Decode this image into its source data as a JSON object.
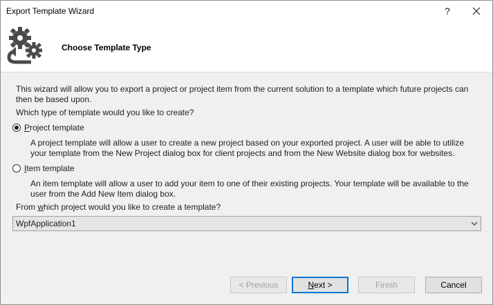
{
  "window": {
    "title": "Export Template Wizard",
    "help_label": "?"
  },
  "header": {
    "page_title": "Choose Template Type"
  },
  "content": {
    "intro": "This wizard will allow you to export a project or project item from the current solution to a template which future projects can then be based upon.",
    "question": "Which type of template would you like to create?",
    "options": [
      {
        "access_key": "P",
        "label_rest": "roject template",
        "checked": true,
        "description": "A project template will allow a user to create a new project based on your exported project. A user will be able to utilize your template from the New Project dialog box for client projects and from the New Website dialog box for websites."
      },
      {
        "access_key": "I",
        "label_rest": "tem template",
        "checked": false,
        "description": "An item template will allow a user to add your item to one of their existing projects. Your template will be available to the user from the Add New Item dialog box."
      }
    ],
    "project_question_pre": "From ",
    "project_question_key": "w",
    "project_question_post": "hich project would you like to create a template?",
    "project_select": {
      "value": "WpfApplication1"
    }
  },
  "buttons": {
    "previous": {
      "label": "< Previous",
      "enabled": false
    },
    "next": {
      "pre": "",
      "key": "N",
      "post": "ext >",
      "enabled": true
    },
    "finish": {
      "label": "Finish",
      "enabled": false
    },
    "cancel": {
      "label": "Cancel",
      "enabled": true
    }
  }
}
